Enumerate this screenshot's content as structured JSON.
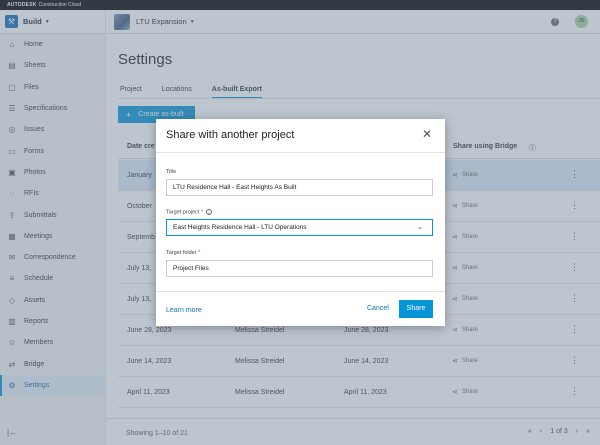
{
  "brand": {
    "name": "AUTODESK",
    "product": "Construction Cloud"
  },
  "header": {
    "app_label": "Build",
    "project_name": "LTU Expansion",
    "help_icon": "?",
    "user_initials": "JS"
  },
  "sidebar": {
    "items": [
      {
        "label": "Home",
        "icon": "home-icon"
      },
      {
        "label": "Sheets",
        "icon": "sheets-icon"
      },
      {
        "label": "Files",
        "icon": "files-icon"
      },
      {
        "label": "Specifications",
        "icon": "specifications-icon"
      },
      {
        "label": "Issues",
        "icon": "issues-icon"
      },
      {
        "label": "Forms",
        "icon": "forms-icon"
      },
      {
        "label": "Photos",
        "icon": "photos-icon"
      },
      {
        "label": "RFIs",
        "icon": "rfis-icon"
      },
      {
        "label": "Submittals",
        "icon": "submittals-icon"
      },
      {
        "label": "Meetings",
        "icon": "meetings-icon"
      },
      {
        "label": "Correspondence",
        "icon": "correspondence-icon"
      },
      {
        "label": "Schedule",
        "icon": "schedule-icon"
      },
      {
        "label": "Assets",
        "icon": "assets-icon"
      },
      {
        "label": "Reports",
        "icon": "reports-icon"
      },
      {
        "label": "Members",
        "icon": "members-icon"
      },
      {
        "label": "Bridge",
        "icon": "bridge-icon"
      },
      {
        "label": "Settings",
        "icon": "settings-icon",
        "active": true
      }
    ]
  },
  "page": {
    "title": "Settings",
    "tabs": [
      {
        "label": "Project"
      },
      {
        "label": "Locations"
      },
      {
        "label": "As-built Export",
        "active": true
      }
    ],
    "create_button": "Create as-built"
  },
  "table": {
    "columns": [
      "Date cre",
      "Share using Bridge"
    ],
    "rows": [
      {
        "date": "January",
        "creator": "",
        "created": "",
        "share": "Share",
        "selected": true
      },
      {
        "date": "October",
        "creator": "",
        "created": "",
        "share": "Share"
      },
      {
        "date": "Septemb",
        "creator": "",
        "created": "",
        "share": "Share"
      },
      {
        "date": "July 13,",
        "creator": "",
        "created": "",
        "share": "Share"
      },
      {
        "date": "July 13,",
        "creator": "",
        "created": "",
        "share": "Share"
      },
      {
        "date": "June 28, 2023",
        "creator": "Melissa Streidel",
        "created": "June 28, 2023",
        "share": "Share"
      },
      {
        "date": "June 14, 2023",
        "creator": "Melissa Streidel",
        "created": "June 14, 2023",
        "share": "Share"
      },
      {
        "date": "April 11, 2023",
        "creator": "Melissa Streidel",
        "created": "April 11, 2023",
        "share": "Share"
      }
    ]
  },
  "footer": {
    "showing": "Showing 1–10 of 21",
    "page_of": "1 of 3"
  },
  "modal": {
    "title": "Share with another project",
    "title_label": "Title",
    "title_value": "LTU Residence Hall - East Heights As Built",
    "target_project_label": "Target project",
    "target_project_value": "East Heights Residence Hall - LTU Operations",
    "target_folder_label": "Target folder",
    "target_folder_value": "Project Files",
    "required_mark": "*",
    "learn_more": "Learn more",
    "cancel": "Cancel",
    "share": "Share"
  },
  "colors": {
    "accent": "#0696d7",
    "link": "#0f6fb3",
    "required": "#d53b3b"
  }
}
